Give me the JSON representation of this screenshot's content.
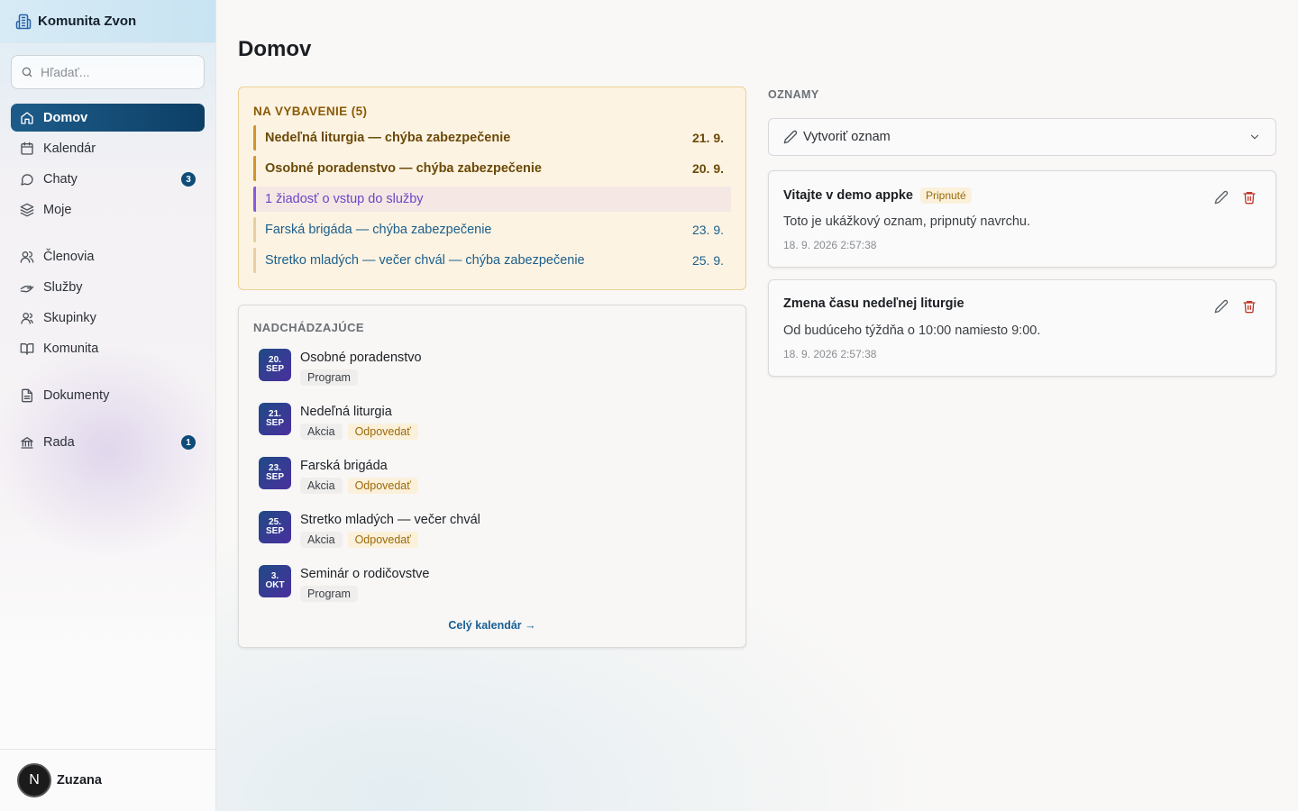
{
  "brand": {
    "name": "Komunita Zvon",
    "icon": "building-icon"
  },
  "search": {
    "placeholder": "Hľadať..."
  },
  "nav": {
    "primary": [
      {
        "label": "Domov",
        "icon": "home-icon",
        "active": true
      },
      {
        "label": "Kalendár",
        "icon": "calendar-icon"
      },
      {
        "label": "Chaty",
        "icon": "chat-icon",
        "badge": "3"
      },
      {
        "label": "Moje",
        "icon": "layers-icon"
      }
    ],
    "secondary": [
      {
        "label": "Členovia",
        "icon": "users-icon"
      },
      {
        "label": "Služby",
        "icon": "handshake-icon"
      },
      {
        "label": "Skupinky",
        "icon": "group-icon"
      },
      {
        "label": "Komunita",
        "icon": "book-icon"
      }
    ],
    "docs": [
      {
        "label": "Dokumenty",
        "icon": "document-icon"
      }
    ],
    "council": [
      {
        "label": "Rada",
        "icon": "bank-icon",
        "badge": "1"
      }
    ]
  },
  "user": {
    "initial": "N",
    "name": "Zuzana"
  },
  "page": {
    "title": "Domov"
  },
  "pending": {
    "heading": "NA VYBAVENIE (5)",
    "items": [
      {
        "text": "Nedeľná liturgia — chýba zabezpečenie",
        "date": "21. 9.",
        "kind": "warn"
      },
      {
        "text": "Osobné poradenstvo — chýba zabezpečenie",
        "date": "20. 9.",
        "kind": "warn"
      },
      {
        "text": "1 žiadosť o vstup do služby",
        "date": "",
        "kind": "req"
      },
      {
        "text": "Farská brigáda — chýba zabezpečenie",
        "date": "23. 9.",
        "kind": "info"
      },
      {
        "text": "Stretko mladých — večer chvál — chýba zabezpečenie",
        "date": "25. 9.",
        "kind": "info"
      }
    ]
  },
  "upcoming": {
    "heading": "NADCHÁDZAJÚCE",
    "events": [
      {
        "day": "20.",
        "month": "SEP",
        "name": "Osobné poradenstvo",
        "kind": "Program",
        "rsvp": ""
      },
      {
        "day": "21.",
        "month": "SEP",
        "name": "Nedeľná liturgia",
        "kind": "Akcia",
        "rsvp": "Odpovedať"
      },
      {
        "day": "23.",
        "month": "SEP",
        "name": "Farská brigáda",
        "kind": "Akcia",
        "rsvp": "Odpovedať"
      },
      {
        "day": "25.",
        "month": "SEP",
        "name": "Stretko mladých — večer chvál",
        "kind": "Akcia",
        "rsvp": "Odpovedať"
      },
      {
        "day": "3.",
        "month": "OKT",
        "name": "Seminár o rodičovstve",
        "kind": "Program",
        "rsvp": ""
      }
    ],
    "calendar_link": "Celý kalendár →"
  },
  "announcements": {
    "heading": "OZNAMY",
    "create_label": "Vytvoriť oznam",
    "items": [
      {
        "title": "Vitajte v demo appke",
        "pinned": "Pripnuté",
        "body": "Toto je ukážkový oznam, pripnutý navrchu.",
        "time": "18. 9. 2026 2:57:38"
      },
      {
        "title": "Zmena času nedeľnej liturgie",
        "pinned": "",
        "body": "Od budúceho týždňa o 10:00 namiesto 9:00.",
        "time": "18. 9. 2026 2:57:38"
      }
    ]
  },
  "colors": {
    "accent": "#0f4b78",
    "warning": "#d1962a",
    "request": "#8a5ad6",
    "danger": "#c0392b"
  }
}
